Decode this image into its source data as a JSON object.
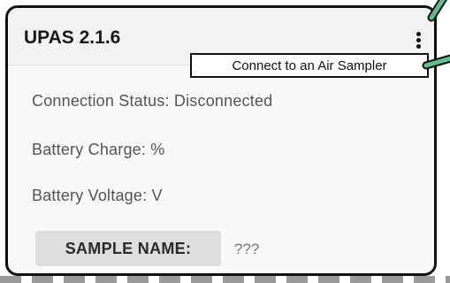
{
  "app": {
    "title": "UPAS 2.1.6"
  },
  "status": {
    "connection": "Connection Status: Disconnected",
    "battery_charge": "Battery Charge: %",
    "battery_voltage": "Battery Voltage: V"
  },
  "sample": {
    "button_label": "SAMPLE NAME:",
    "value": "???"
  },
  "callout": {
    "text": "Connect to an Air Sampler"
  },
  "icons": {
    "menu": "more-vert-icon"
  },
  "colors": {
    "pointer": "#5fbf8f",
    "frame": "#111111",
    "button_bg": "#dedede"
  }
}
